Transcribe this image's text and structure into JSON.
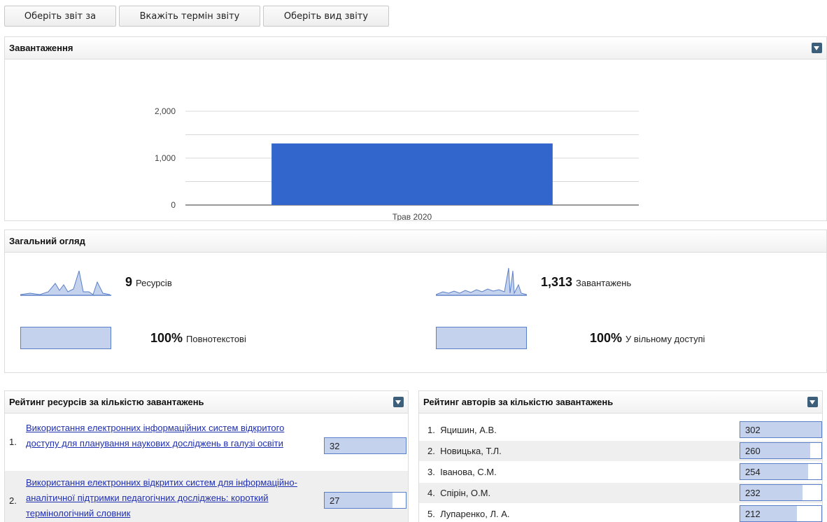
{
  "top_buttons": [
    "Оберіть звіт за",
    "Вкажіть термін звіту",
    "Оберіть вид звіту"
  ],
  "downloads_panel": {
    "title": "Завантаження",
    "chart_data": {
      "type": "bar",
      "categories": [
        "Трав 2020"
      ],
      "values": [
        1313
      ],
      "ylim": [
        0,
        2000
      ],
      "yticks": [
        0,
        1000,
        2000
      ],
      "ytick_labels": [
        "0",
        "1,000",
        "2,000"
      ],
      "grid": true,
      "bar_color": "#3366cc"
    }
  },
  "overview_panel": {
    "title": "Загальний огляд",
    "resources": {
      "value": "9",
      "label": "Ресурсів"
    },
    "downloads": {
      "value": "1,313",
      "label": "Завантажень"
    },
    "fulltext": {
      "value": "100%",
      "label": "Повнотекстові"
    },
    "open_access": {
      "value": "100%",
      "label": "У вільному доступі"
    }
  },
  "resources_ranking": {
    "title": "Рейтинг ресурсів за кількістю завантажень",
    "items": [
      {
        "rank": "1.",
        "title": "Використання електронних інформаційних систем відкритого доступу для планування наукових досліджень в галузі освіти",
        "value": "32",
        "fraction": 1.0
      },
      {
        "rank": "2.",
        "title": "Використання електронних відкритих систем для інформаційно-аналітичної підтримки педагогічних досліджень: короткий термінологічний словник",
        "value": "27",
        "fraction": 0.84
      }
    ]
  },
  "authors_ranking": {
    "title": "Рейтинг авторів за кількістю завантажень",
    "items": [
      {
        "rank": "1.",
        "name": "Яцишин, А.В.",
        "value": "302",
        "fraction": 1.0
      },
      {
        "rank": "2.",
        "name": "Новицька, Т.Л.",
        "value": "260",
        "fraction": 0.86
      },
      {
        "rank": "3.",
        "name": "Іванова, С.М.",
        "value": "254",
        "fraction": 0.84
      },
      {
        "rank": "4.",
        "name": "Спірін, О.М.",
        "value": "232",
        "fraction": 0.77
      },
      {
        "rank": "5.",
        "name": "Лупаренко, Л. А.",
        "value": "212",
        "fraction": 0.7
      }
    ]
  },
  "colors": {
    "bar": "#3366cc",
    "box_fill": "#c4d2ee",
    "box_border": "#5a7fc6",
    "link": "#1f2fb0"
  }
}
